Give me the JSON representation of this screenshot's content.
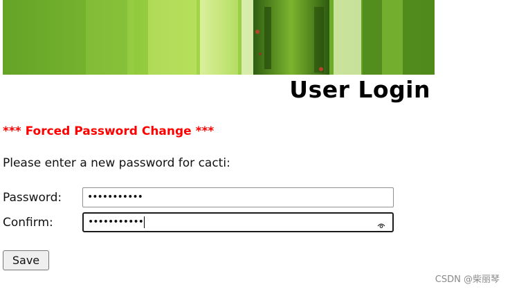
{
  "banner": {
    "image": "agave-leaves-banner",
    "title": "User Login"
  },
  "form": {
    "notice": "*** Forced Password Change ***",
    "instruction": "Please enter a new password for cacti:",
    "password_label": "Password:",
    "password_value": "•••••••••••",
    "confirm_label": "Confirm:",
    "confirm_value": "•••••••••••",
    "save_label": "Save",
    "reveal_icon": "eye-icon"
  },
  "colors": {
    "notice": "#ff0000",
    "banner_green": "#7fbf2a"
  },
  "watermark": "CSDN @柴丽琴"
}
